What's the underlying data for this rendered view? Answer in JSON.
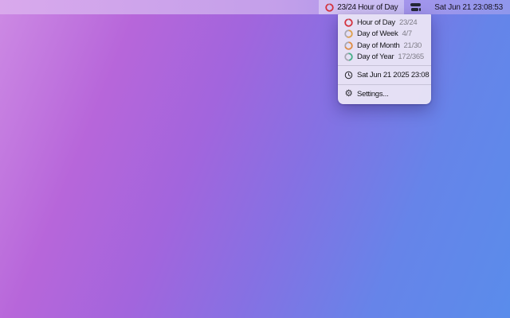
{
  "menu_bar": {
    "hour_item": {
      "label": "23/24 Hour of Day",
      "fraction": 0.958,
      "color": "#d7303e"
    },
    "clock_label": "Sat Jun 21 23:08:53"
  },
  "dropdown": {
    "rings": [
      {
        "label": "Hour of Day",
        "value": "23/24",
        "fraction": 0.958,
        "color": "#d7303e"
      },
      {
        "label": "Day of Week",
        "value": "4/7",
        "fraction": 0.571,
        "color": "#e2a048"
      },
      {
        "label": "Day of Month",
        "value": "21/30",
        "fraction": 0.7,
        "color": "#e28c40"
      },
      {
        "label": "Day of Year",
        "value": "172/365",
        "fraction": 0.471,
        "color": "#44b189"
      }
    ],
    "datetime_label": "Sat Jun 21 2025 23:08",
    "settings_label": "Settings...",
    "gear_glyph": "⚙"
  },
  "colors": {
    "ring_track": "#a8a6b2",
    "menu_text": "#141418",
    "menu_value": "#7f7d88"
  }
}
